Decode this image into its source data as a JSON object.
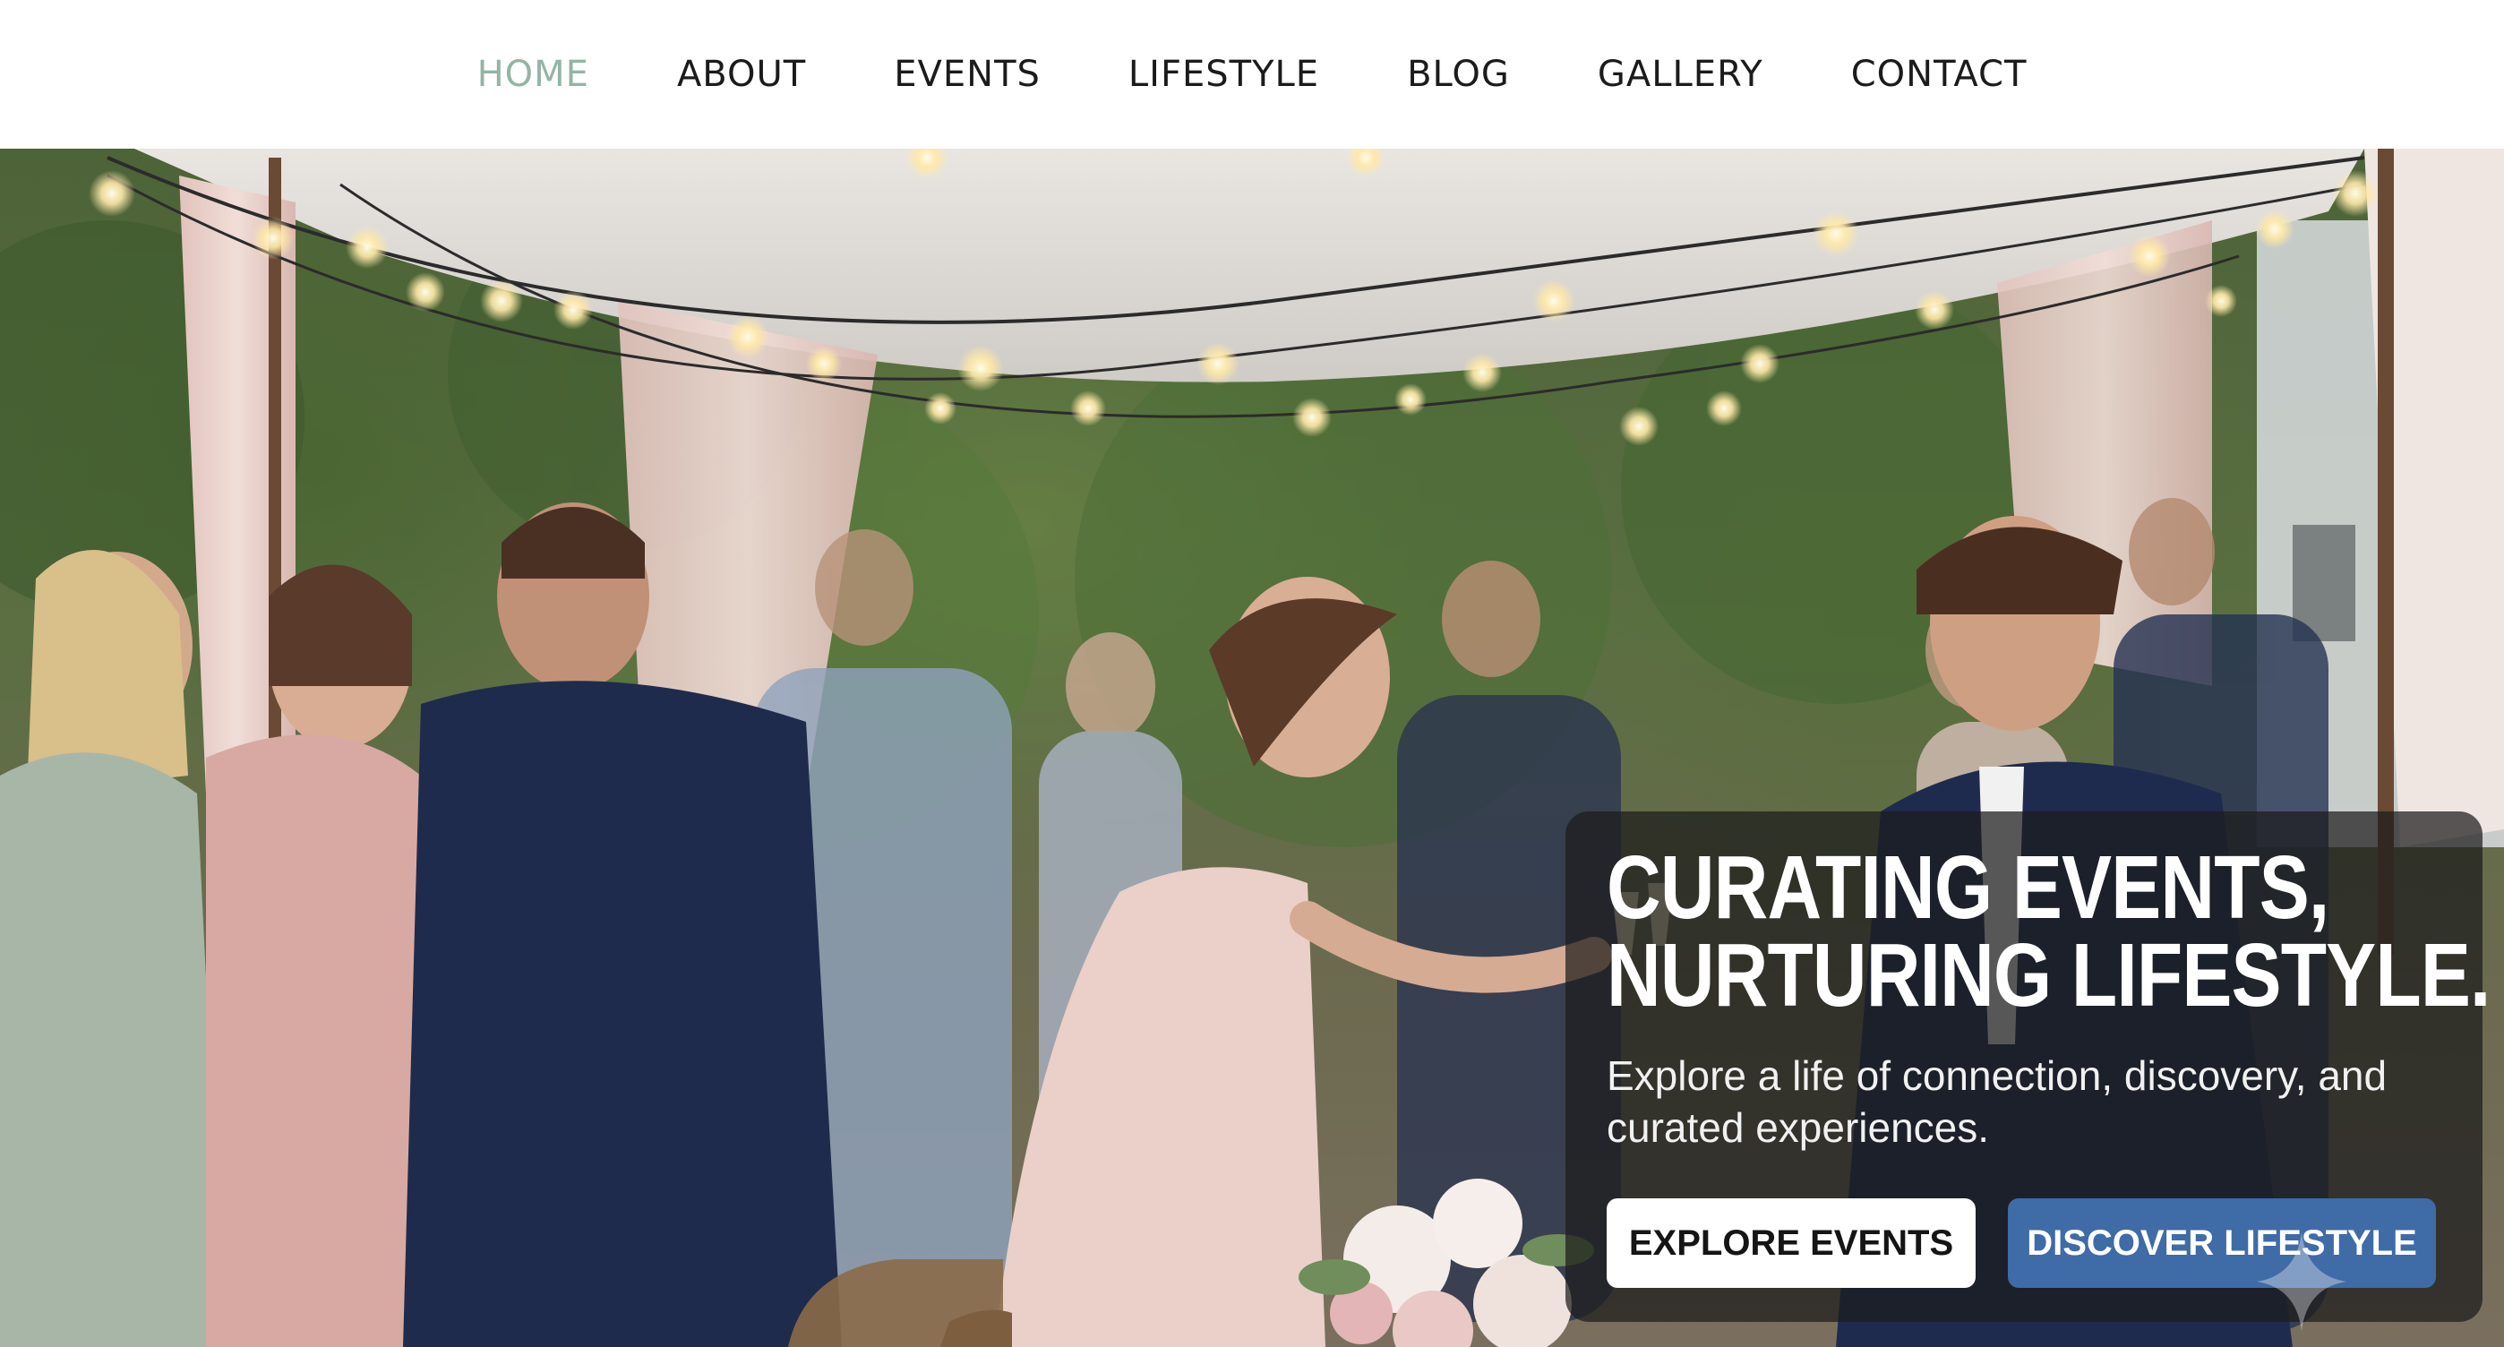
{
  "nav": {
    "items": [
      {
        "label": "HOME",
        "active": true
      },
      {
        "label": "ABOUT",
        "active": false
      },
      {
        "label": "EVENTS",
        "active": false
      },
      {
        "label": "LIFESTYLE",
        "active": false
      },
      {
        "label": "BLOG",
        "active": false
      },
      {
        "label": "GALLERY",
        "active": false
      },
      {
        "label": "CONTACT",
        "active": false
      }
    ]
  },
  "hero": {
    "title_line1": "CURATING EVENTS,",
    "title_line2": "NURTURING LIFESTYLE.",
    "subtitle": "Explore a life of connection, discovery, and curated experiences.",
    "primary_button": "EXPLORE EVENTS",
    "secondary_button": "DISCOVER LIFESTYLE",
    "image_icon": "sparkle-icon"
  },
  "colors": {
    "nav_active": "#93b5a4",
    "nav_text": "#1b1b1b",
    "button_blue": "#3f6ba6",
    "card_overlay": "rgba(28,28,28,0.72)"
  }
}
